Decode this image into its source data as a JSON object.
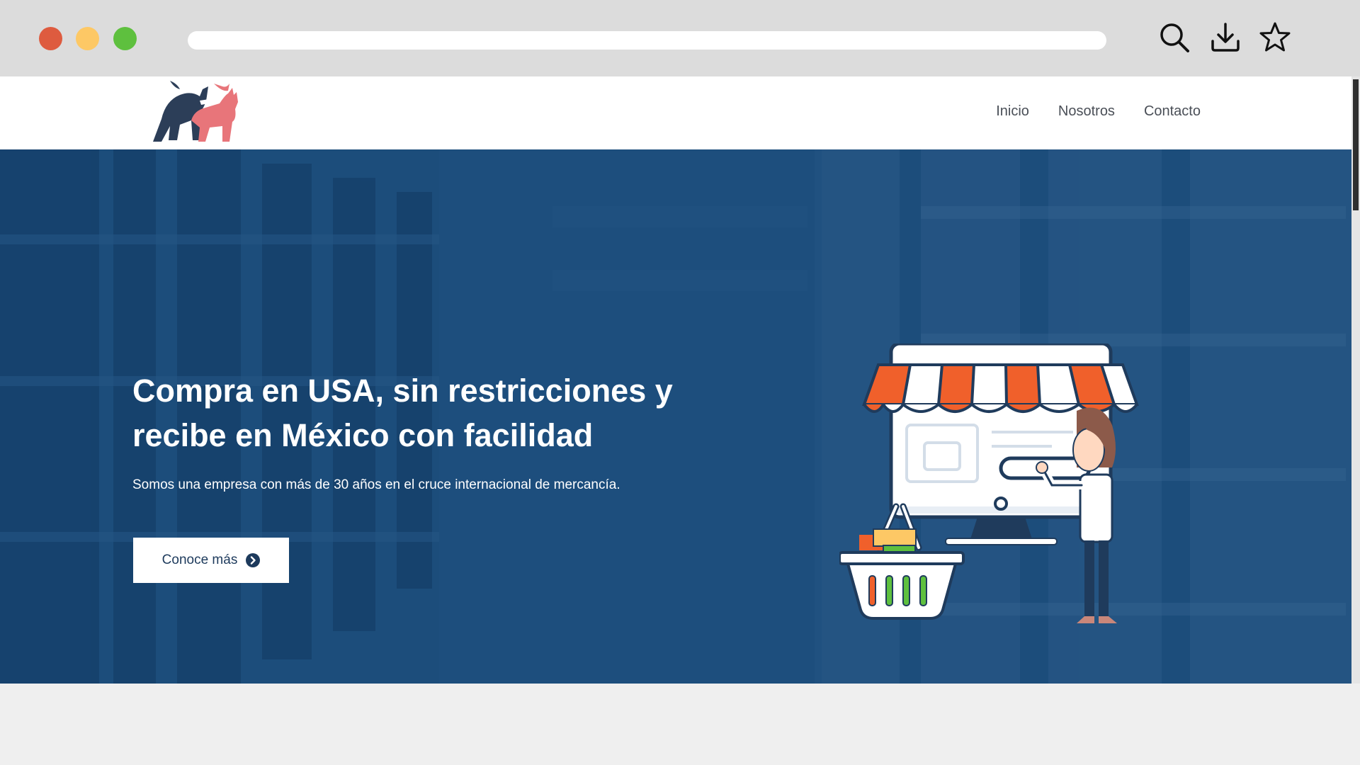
{
  "browser": {
    "icons": [
      "search-icon",
      "download-icon",
      "star-icon"
    ],
    "colors": {
      "close": "#de5b3f",
      "minimize": "#fdc865",
      "maximize": "#5ec03e"
    }
  },
  "header": {
    "logo": "bull-and-bear-logo",
    "nav": [
      {
        "label": "Inicio"
      },
      {
        "label": "Nosotros"
      },
      {
        "label": "Contacto"
      }
    ]
  },
  "hero": {
    "title_line1": "Compra en USA, sin restricciones y",
    "title_line2": "recibe en México con facilidad",
    "subtitle": "Somos una empresa con más de 30 años en el cruce internacional de mercancía.",
    "cta_label": "Conoce más",
    "cta_icon": "arrow-circle-right-icon",
    "illustration": "online-store-shopping-illustration",
    "colors": {
      "overlay": "#1f4b74",
      "awning": "#f0602b"
    }
  }
}
